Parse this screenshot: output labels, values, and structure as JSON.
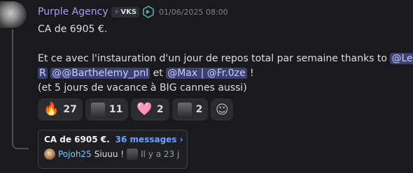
{
  "message": {
    "author": "Purple Agency",
    "tag": "VKS",
    "timestamp": "01/06/2025 08:00",
    "line1": "CA de 6905 €.",
    "line2_text": "Et ce avec l'instauration d'un jour de repos total par semaine thanks to ",
    "line2_mention": "@Le",
    "line3_mention1": "R",
    "line3_mention2": "@@Barthelemy_pnl",
    "line3_mid": " et ",
    "line3_mention3": "@Max | @Fr.0ze",
    "line3_end": " !",
    "line4": "(et 5 jours de vacance à BIG cannes aussi)"
  },
  "reactions": [
    {
      "emoji": "🔥",
      "count": "27"
    },
    {
      "emoji": "person-image",
      "count": "11"
    },
    {
      "emoji": "🩷",
      "count": "2"
    },
    {
      "emoji": "person-image",
      "count": "2"
    }
  ],
  "thread": {
    "title": "CA de 6905 €.",
    "count": "36 messages ›",
    "author": "Pojoh25",
    "message": "Siuuu !",
    "ago": "Il y a 23 j"
  },
  "colors": {
    "background": "#1a1a1e",
    "author": "#a99cf7",
    "mention_bg": "#3c4270",
    "thread_link": "#6aa3ff"
  }
}
